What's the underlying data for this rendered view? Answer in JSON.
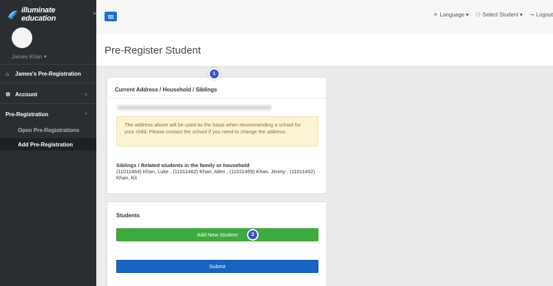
{
  "brand": {
    "name": "illuminate education",
    "tm": "™"
  },
  "user": {
    "name": "James Khan ▾"
  },
  "sidebar": {
    "home": {
      "icon": "home-icon",
      "glyph": "⌂",
      "label": "James's Pre-Registration"
    },
    "account": {
      "icon": "gear-icon",
      "glyph": "⚙",
      "label": "Account",
      "chevron": "<"
    },
    "prereg": {
      "label": "Pre-Registration",
      "chevron": "˅"
    },
    "sub_items": [
      {
        "label": "Open Pre-Registrations"
      },
      {
        "label": "Add Pre-Registration"
      }
    ]
  },
  "topbar": {
    "language": {
      "icon": "translate-icon",
      "glyph": "✈",
      "label": "Language ▾"
    },
    "select_student": {
      "icon": "users-icon",
      "glyph": "⚇",
      "label": "Select Student ▾"
    },
    "logout": {
      "icon": "logout-icon",
      "glyph": "↪",
      "label": "Logout"
    }
  },
  "page": {
    "title": "Pre-Register Student"
  },
  "address_panel": {
    "title": "Current Address / Household / Siblings",
    "notice": "The address above will be used as the basis when recommending a school for your child. Please contact the school if you need to change the address.",
    "siblings_title": "Siblings / Related students in the family or household",
    "siblings_text": "(11011464) Khan, Luke , (11011462) Khan, Allen , (11011459) Khan, Jimmy , (11011452) Khan, Kit"
  },
  "students_panel": {
    "title": "Students",
    "add_label": "Add New Student",
    "submit_label": "Submit"
  },
  "badges": {
    "one": "1",
    "two": "2"
  },
  "colors": {
    "sidebar": "#2a2e33",
    "primary": "#1763c0",
    "success": "#3eab3f",
    "badge": "#3a55c8",
    "notice_bg": "#fcf4d4"
  }
}
